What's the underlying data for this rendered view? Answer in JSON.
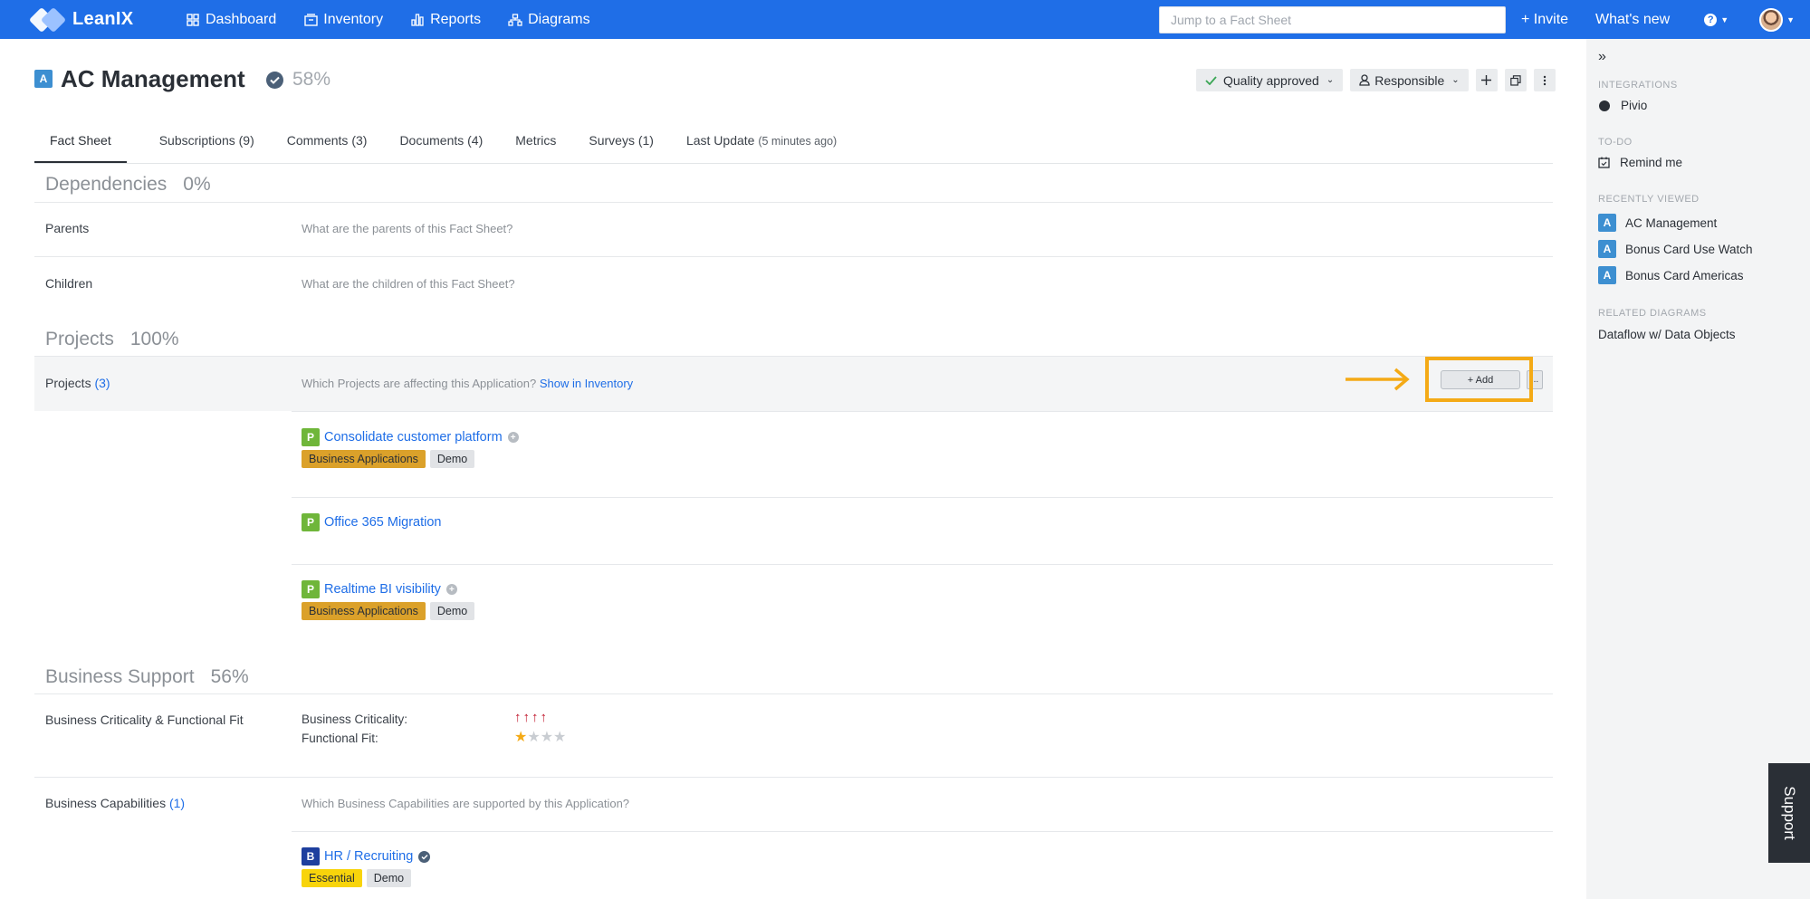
{
  "nav": {
    "brand": "LeanIX",
    "items": [
      {
        "label": "Dashboard",
        "icon": "grid-icon"
      },
      {
        "label": "Inventory",
        "icon": "inventory-icon"
      },
      {
        "label": "Reports",
        "icon": "bar-chart-icon"
      },
      {
        "label": "Diagrams",
        "icon": "diagram-icon"
      }
    ],
    "search_placeholder": "Jump to a Fact Sheet",
    "invite": "+ Invite",
    "whats_new": "What's new",
    "help": "?"
  },
  "factsheet": {
    "type_letter": "A",
    "title": "AC Management",
    "completion": "58%",
    "quality": "Quality approved",
    "responsible": "Responsible"
  },
  "tabs": [
    {
      "label": "Fact Sheet",
      "sub": ""
    },
    {
      "label": "Subscriptions (9)",
      "sub": ""
    },
    {
      "label": "Comments (3)",
      "sub": ""
    },
    {
      "label": "Documents (4)",
      "sub": ""
    },
    {
      "label": "Metrics",
      "sub": ""
    },
    {
      "label": "Surveys (1)",
      "sub": ""
    },
    {
      "label": "Last Update",
      "sub": "(5 minutes ago)"
    }
  ],
  "dependencies": {
    "title": "Dependencies",
    "pct": "0%",
    "parents_label": "Parents",
    "parents_ph": "What are the parents of this Fact Sheet?",
    "children_label": "Children",
    "children_ph": "What are the children of this Fact Sheet?"
  },
  "projects": {
    "title": "Projects",
    "pct": "100%",
    "row_label": "Projects",
    "count": "(3)",
    "ph": "Which Projects are affecting this Application?",
    "link": "Show in Inventory",
    "add": "+ Add",
    "more": "...",
    "items": [
      {
        "letter": "P",
        "name": "Consolidate customer platform",
        "tags": [
          "Business Applications",
          "Demo"
        ]
      },
      {
        "letter": "P",
        "name": "Office 365 Migration",
        "tags": []
      },
      {
        "letter": "P",
        "name": "Realtime BI visibility",
        "tags": [
          "Business Applications",
          "Demo"
        ]
      }
    ]
  },
  "business_support": {
    "title": "Business Support",
    "pct": "56%",
    "crit_row_label": "Business Criticality & Functional Fit",
    "crit_label": "Business Criticality:",
    "fit_label": "Functional Fit:",
    "criticality_level": 4,
    "criticality_max": 4,
    "functional_fit": 1,
    "functional_fit_max": 4,
    "caps_label": "Business Capabilities",
    "caps_count": "(1)",
    "caps_ph": "Which Business Capabilities are supported by this Application?",
    "cap_item": {
      "letter": "B",
      "name": "HR / Recruiting",
      "tags": [
        "Essential",
        "Demo"
      ]
    }
  },
  "right_panel": {
    "integrations_head": "INTEGRATIONS",
    "integration": "Pivio",
    "todo_head": "TO-DO",
    "todo": "Remind me",
    "recent_head": "RECENTLY VIEWED",
    "recent": [
      {
        "letter": "A",
        "name": "AC Management"
      },
      {
        "letter": "A",
        "name": "Bonus Card Use Watch"
      },
      {
        "letter": "A",
        "name": "Bonus Card Americas"
      }
    ],
    "diagrams_head": "RELATED DIAGRAMS",
    "diagram": "Dataflow w/ Data Objects"
  },
  "support": "Support",
  "colors": {
    "brand_blue": "#1f6ee7",
    "highlight": "#f4aa16",
    "project_green": "#6fb63a",
    "tag_business_apps": "#dba12a",
    "tag_essential": "#f8d40b",
    "criticality_red": "#c0152a"
  }
}
